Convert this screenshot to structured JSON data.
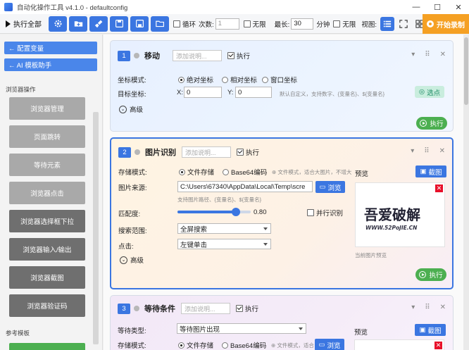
{
  "window": {
    "title": "自动化操作工具 v4.1.0 - defaultconfig",
    "controls": [
      "—",
      "☐",
      "✕"
    ]
  },
  "toolbar": {
    "run_all": "执行全部",
    "buttons": [
      "gear-icon",
      "add-folder-icon",
      "broom-icon",
      "save-icon",
      "save-as-icon",
      "open-folder-icon"
    ],
    "loop_label": "循环",
    "count_label": "次数:",
    "count_value": "1",
    "unlimited_label": "无限",
    "max_len_label": "最长:",
    "max_len_value": "30",
    "minute_label": "分钟",
    "unlimited2_label": "无限",
    "view_label": "视图:",
    "record_label": "开始录制"
  },
  "sidebar": {
    "config_vars": "← 配置变量",
    "ai_helper": "← AI 模板助手",
    "section_browser": "浏览器操作",
    "browser_ops": [
      "浏览器管理",
      "页面跳转",
      "等待元素",
      "浏览器点击",
      "浏览器选择框下拉",
      "浏览器输入/输出",
      "浏览器截图",
      "浏览器验证码"
    ],
    "section_ref": "参考模板"
  },
  "cards": {
    "move": {
      "num": "1",
      "title": "移动",
      "desc_placeholder": "添加说明...",
      "exec_label": "执行",
      "coord_mode_label": "坐标模式:",
      "modes": [
        "绝对坐标",
        "相对坐标",
        "窗口坐标"
      ],
      "target_label": "目标坐标:",
      "x_label": "X:",
      "x_value": "0",
      "y_label": "Y:",
      "y_value": "0",
      "hint": "默认自定义，支持数字、{变量名}、${变量名}",
      "pick_label": "选点",
      "advanced_label": "高级",
      "run_label": "执行"
    },
    "image": {
      "num": "2",
      "title": "图片识别",
      "desc_placeholder": "添加说明...",
      "exec_label": "执行",
      "storage_label": "存储模式:",
      "storage_modes": [
        "文件存储",
        "Base64编码"
      ],
      "storage_hint": "文件模式，适合大图片，不增大",
      "source_label": "图片来源:",
      "source_value": "C:\\Users\\67340\\AppData\\Local\\Temp\\scre",
      "browse_label": "浏览",
      "source_hint": "支持图片路径、{变量名}、${变量名}",
      "match_label": "匹配度:",
      "match_value": "0.80",
      "match_fraction": 0.8,
      "parallel_label": "并行识别",
      "range_label": "搜索范围:",
      "range_value": "全屏搜索",
      "click_label": "点击:",
      "click_value": "左键单击",
      "preview_label": "预览",
      "screenshot_label": "截图",
      "preview_caption": "当前图片预览",
      "logo_text": "吾爱破解",
      "logo_url": "WWW.52PoJIE.CN",
      "advanced_label": "高级",
      "run_label": "执行"
    },
    "wait": {
      "num": "3",
      "title": "等待条件",
      "desc_placeholder": "添加说明...",
      "exec_label": "执行",
      "wait_type_label": "等待类型:",
      "wait_type_value": "等待图片出现",
      "storage_label": "存储模式:",
      "storage_modes": [
        "文件存储",
        "Base64编码"
      ],
      "storage_hint": "文件模式，适合",
      "browse_label": "浏览",
      "preview_label": "预览",
      "screenshot_label": "截图"
    }
  },
  "colors": {
    "accent": "#3b76e1",
    "record": "#f5a023",
    "run": "#4caf50",
    "close": "#e8102a"
  }
}
